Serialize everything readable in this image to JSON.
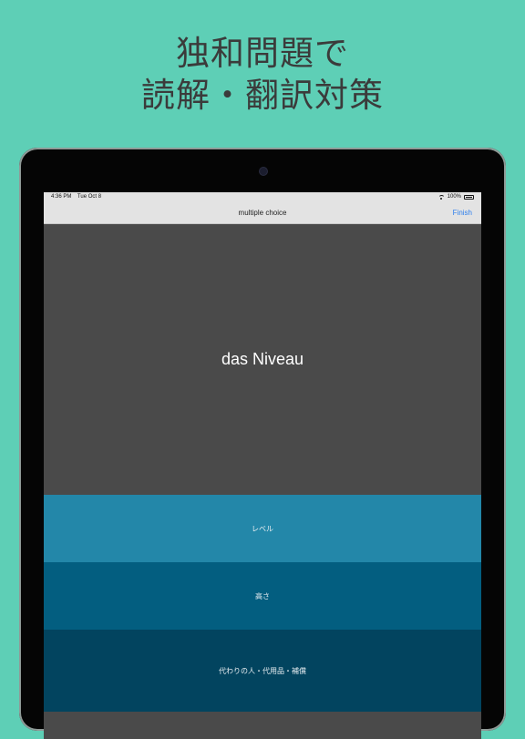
{
  "headline": {
    "line1": "独和問題で",
    "line2": "読解・翻訳対策"
  },
  "status_bar": {
    "time": "4:36 PM",
    "date": "Tue Oct 8",
    "battery": "100%"
  },
  "nav": {
    "title": "multiple choice",
    "finish_label": "Finish"
  },
  "question": {
    "word": "das Niveau"
  },
  "choices": [
    {
      "label": "レベル"
    },
    {
      "label": "高さ"
    },
    {
      "label": "代わりの人・代用品・補償"
    }
  ],
  "colors": {
    "background": "#5ecfb6",
    "question_bg": "#4a4a4a",
    "choice_1": "#2387a9",
    "choice_2": "#035e80",
    "choice_3": "#02445f",
    "accent": "#2f80ed"
  }
}
